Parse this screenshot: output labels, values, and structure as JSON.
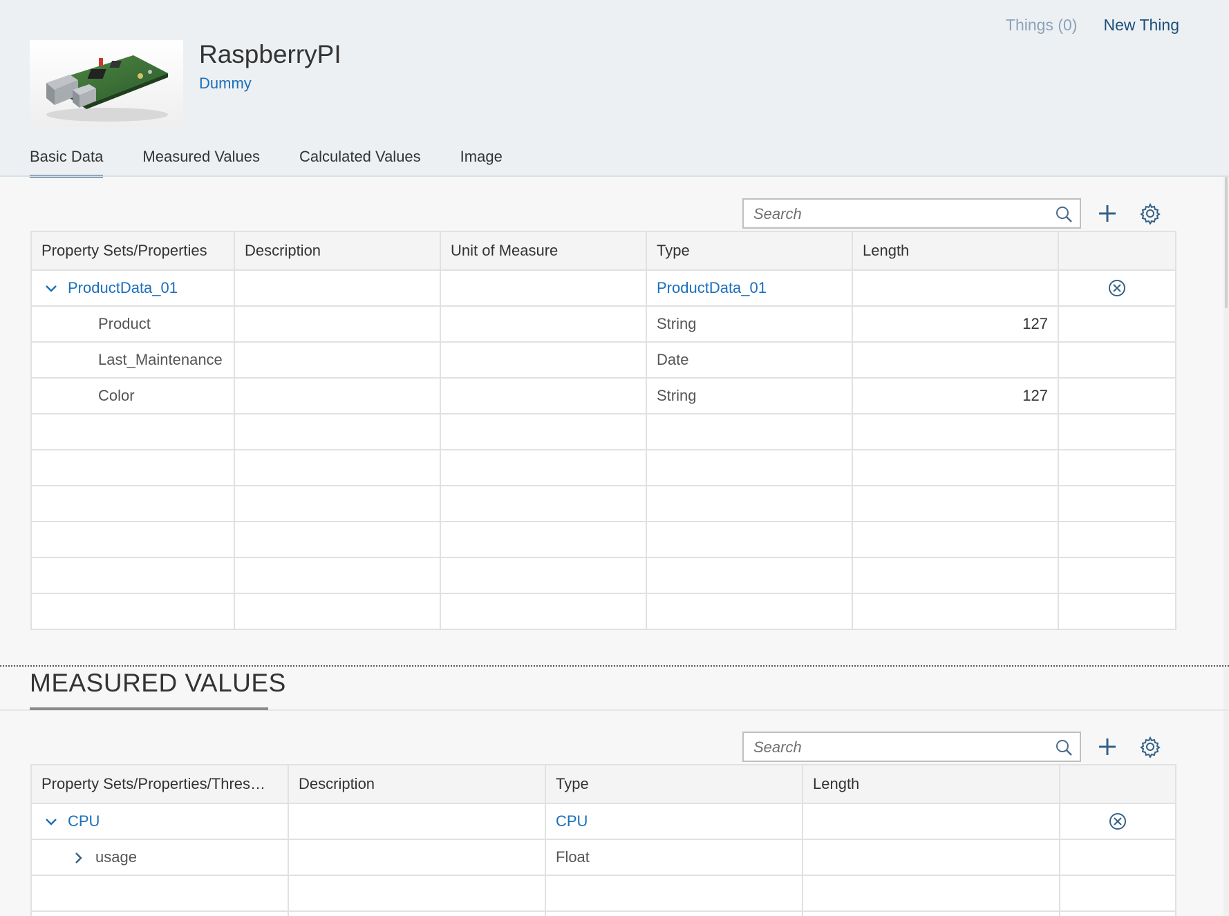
{
  "header": {
    "things_link": "Things (0)",
    "new_thing_link": "New Thing",
    "title": "RaspberryPI",
    "subtitle": "Dummy"
  },
  "tabs": [
    {
      "label": "Basic Data",
      "selected": true
    },
    {
      "label": "Measured Values",
      "selected": false
    },
    {
      "label": "Calculated Values",
      "selected": false
    },
    {
      "label": "Image",
      "selected": false
    }
  ],
  "basic_data": {
    "search_placeholder": "Search",
    "columns": [
      "Property Sets/Properties",
      "Description",
      "Unit of Measure",
      "Type",
      "Length",
      ""
    ],
    "rows": [
      {
        "name": "ProductData_01",
        "description": "",
        "unit": "",
        "type": "ProductData_01",
        "length": "",
        "level": 0
      },
      {
        "name": "Product",
        "description": "",
        "unit": "",
        "type": "String",
        "length": "127",
        "level": 1
      },
      {
        "name": "Last_Maintenance",
        "description": "",
        "unit": "",
        "type": "Date",
        "length": "",
        "level": 1
      },
      {
        "name": "Color",
        "description": "",
        "unit": "",
        "type": "String",
        "length": "127",
        "level": 1
      }
    ]
  },
  "measured_values": {
    "section_title": "MEASURED VALUES",
    "search_placeholder": "Search",
    "columns": [
      "Property Sets/Properties/Thres…",
      "Description",
      "Type",
      "Length",
      ""
    ],
    "rows": [
      {
        "name": "CPU",
        "description": "",
        "type": "CPU",
        "length": "",
        "level": 0
      },
      {
        "name": "usage",
        "description": "",
        "type": "Float",
        "length": "",
        "level": 1
      }
    ]
  },
  "colors": {
    "accent": "#346187",
    "link": "#1b6fba",
    "header_bg": "#edf0f3"
  },
  "icons": {
    "search": "search-icon",
    "add": "plus-icon",
    "settings": "gear-icon",
    "remove": "circle-x-icon",
    "expanded": "chevron-down-icon",
    "collapsed": "chevron-right-icon"
  }
}
